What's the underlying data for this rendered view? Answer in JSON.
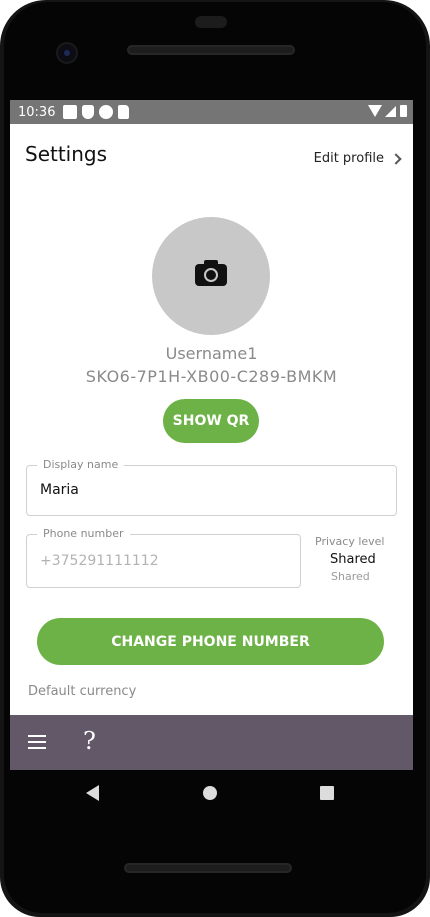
{
  "status_bar": {
    "time": "10:36"
  },
  "header": {
    "title": "Settings",
    "edit_profile": "Edit profile"
  },
  "profile": {
    "avatar_icon": "camera-icon",
    "username": "Username1",
    "user_id": "SKO6-7P1H-XB00-C289-BMKM",
    "show_qr_label": "SHOW QR"
  },
  "display_name": {
    "label": "Display name",
    "value": "Maria"
  },
  "phone": {
    "label": "Phone number",
    "value": "+375291111112"
  },
  "privacy": {
    "label": "Privacy level",
    "selected": "Shared",
    "sub": "Shared"
  },
  "change_phone_label": "CHANGE PHONE NUMBER",
  "default_currency_label": "Default currency",
  "bottom_bar": {
    "menu_icon": "hamburger-menu-icon",
    "help_icon_glyph": "?"
  },
  "colors": {
    "accent_green": "#6db247",
    "bottom_bar": "#635868",
    "status_bar": "#757575",
    "avatar_bg": "#c8c8c8"
  }
}
